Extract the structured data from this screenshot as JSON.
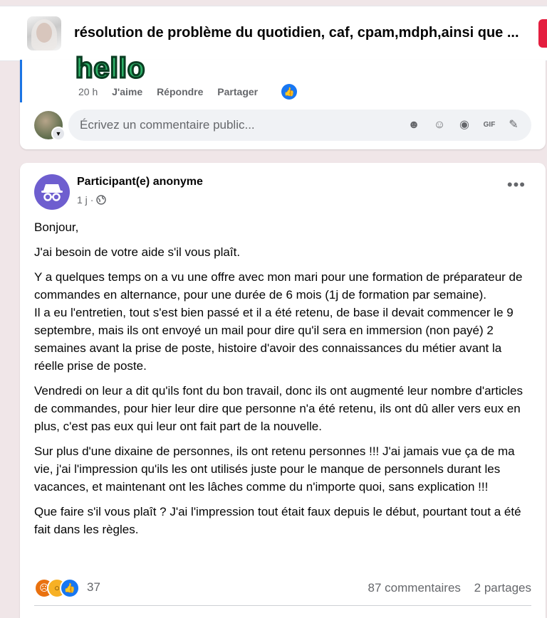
{
  "header": {
    "group_title": "résolution de problème du quotidien, caf, cpam,mdph,ainsi que ..."
  },
  "previous_comment": {
    "gif_text": "hello",
    "time": "20 h",
    "like_label": "J'aime",
    "reply_label": "Répondre",
    "share_label": "Partager",
    "reaction_icon": "like-icon"
  },
  "comment_box": {
    "placeholder": "Écrivez un commentaire public...",
    "icons": [
      "avatar-sticker-icon",
      "emoji-icon",
      "camera-icon",
      "gif-icon",
      "sticker-icon"
    ]
  },
  "post": {
    "author": "Participant(e) anonyme",
    "meta_time": "1 j",
    "meta_separator": "·",
    "audience_icon": "globe-icon",
    "paragraphs": [
      "Bonjour,",
      "J'ai besoin de votre aide s'il vous plaît.",
      "Y a quelques temps on a vu une offre avec mon mari pour une formation de préparateur de commandes en alternance, pour une durée de 6 mois (1j de formation par semaine).\nIl a eu l'entretien, tout s'est bien passé et il a été retenu, de base il devait commencer le 9 septembre, mais ils ont envoyé un mail pour dire qu'il sera en immersion (non payé) 2 semaines avant la prise de poste, histoire d'avoir des connaissances du métier avant la réelle prise de poste.",
      "Vendredi on leur a dit qu'ils font du bon travail, donc ils ont augmenté leur nombre d'articles de commandes, pour hier leur dire que personne n'a été retenu, ils ont dû aller vers eux en plus, c'est pas eux qui leur ont fait part de la nouvelle.",
      "Sur plus d'une dixaine de personnes, ils ont retenu personnes !!! J'ai jamais vue ça de ma vie, j'ai l'impression qu'ils les ont utilisés juste pour le manque de personnels durant les vacances, et maintenant ont les lâches comme du n'importe quoi, sans explication !!!",
      "Que faire s'il vous plaît ? J'ai l'impression tout était faux depuis le début, pourtant tout a été fait dans les règles."
    ],
    "reactions": {
      "icons": [
        "angry-icon",
        "wow-icon",
        "like-icon"
      ],
      "count": "37"
    },
    "comments_count": "87 commentaires",
    "shares_count": "2 partages"
  },
  "colors": {
    "accent": "#1877f2",
    "background": "#f0e6e8",
    "secondary_text": "#65676b",
    "danger_tab": "#e41e3f"
  }
}
